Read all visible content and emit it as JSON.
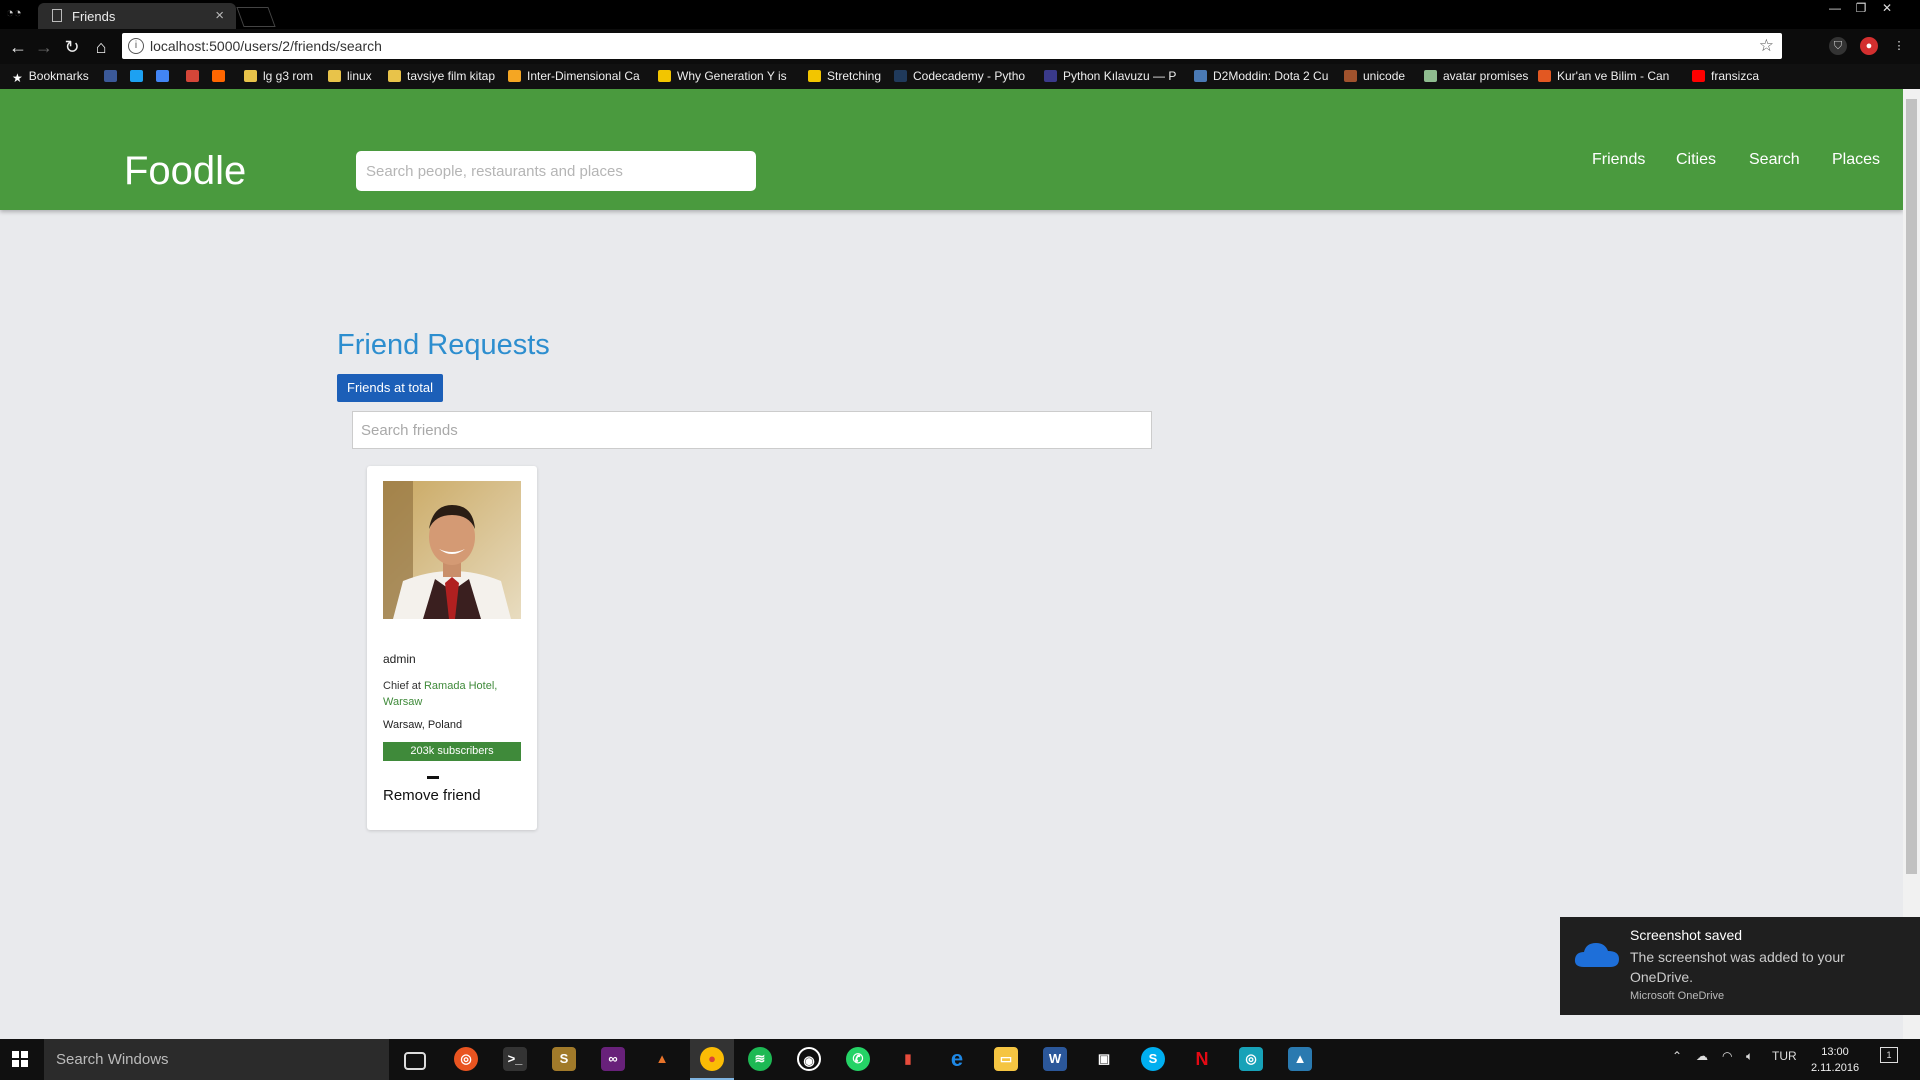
{
  "browser": {
    "tab_title": "Friends",
    "tab_close": "×",
    "url": "localhost:5000/users/2/friends/search",
    "bookmarks": [
      {
        "label": "Bookmarks",
        "color": "#ffffff"
      },
      {
        "label": "",
        "color": "#3b5998"
      },
      {
        "label": "",
        "color": "#1da1f2"
      },
      {
        "label": "",
        "color": "#4285f4"
      },
      {
        "label": "",
        "color": "#d44638"
      },
      {
        "label": "",
        "color": "#ff6600"
      },
      {
        "label": "lg g3 rom",
        "color": "#e8c34a"
      },
      {
        "label": "linux",
        "color": "#e8c34a"
      },
      {
        "label": "tavsiye film kitap",
        "color": "#e8c34a"
      },
      {
        "label": "Inter-Dimensional Ca",
        "color": "#f5a623"
      },
      {
        "label": "Why Generation Y is",
        "color": "#f2c500"
      },
      {
        "label": "Stretching",
        "color": "#f2c500"
      },
      {
        "label": "Codecademy - Pytho",
        "color": "#203a5b"
      },
      {
        "label": "Python Kılavuzu — P",
        "color": "#3a3a8a"
      },
      {
        "label": "D2Moddin: Dota 2 Cu",
        "color": "#4a7ab5"
      },
      {
        "label": "unicode",
        "color": "#a0522d"
      },
      {
        "label": "avatar promises",
        "color": "#8fbc8f"
      },
      {
        "label": "Kur'an ve Bilim - Can",
        "color": "#e25822"
      },
      {
        "label": "fransizca",
        "color": "#ff0000"
      }
    ]
  },
  "app": {
    "brand": "Foodle",
    "search_placeholder": "Search people, restaurants and places",
    "nav": [
      "Friends",
      "Cities",
      "Search",
      "Places"
    ],
    "colors": {
      "header": "#4a9a3e",
      "title": "#2d8ecf",
      "button": "#1c5fb8"
    }
  },
  "page": {
    "title": "Friend Requests",
    "total_button": "Friends at total",
    "friend_search_placeholder": "Search friends"
  },
  "friend": {
    "name": "admin",
    "job_prefix": "Chief at",
    "job_place": "Ramada Hotel, Warsaw",
    "location": "Warsaw, Poland",
    "subscribers": "203k subscribers",
    "action": "Remove friend"
  },
  "toast": {
    "title": "Screenshot saved",
    "body": "The screenshot was added to your OneDrive.",
    "source": "Microsoft OneDrive"
  },
  "taskbar": {
    "search_placeholder": "Search Windows",
    "language": "TUR",
    "time": "13:00",
    "date": "2.11.2016",
    "notification_count": "1"
  }
}
